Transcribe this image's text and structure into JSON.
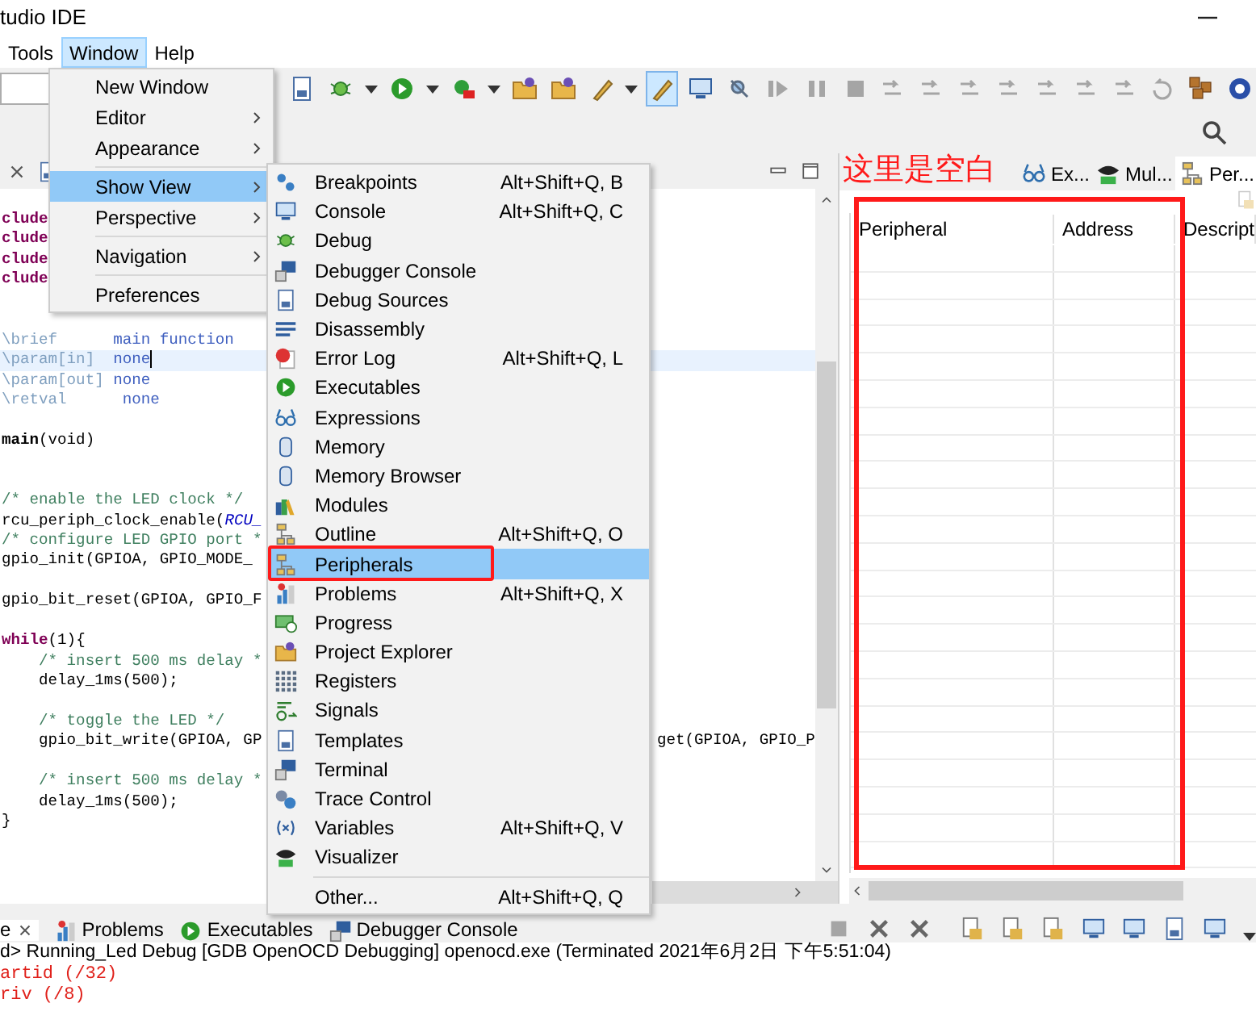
{
  "window": {
    "title": "tudio IDE"
  },
  "menubar": [
    {
      "label": "Tools",
      "selected": false
    },
    {
      "label": "Window",
      "selected": true
    },
    {
      "label": "Help",
      "selected": false
    }
  ],
  "toolbar": [
    {
      "selected": false
    },
    {
      "selected": false
    },
    {
      "selected": false
    },
    {
      "selected": false
    },
    {
      "selected": false
    },
    {
      "selected": false
    },
    {
      "selected": false
    },
    {
      "selected": false
    },
    {
      "selected": false
    },
    {
      "selected": false
    },
    {
      "selected": false
    },
    {
      "selected": true
    },
    {
      "selected": false
    },
    {
      "selected": false
    },
    {
      "selected": false
    },
    {
      "selected": false
    },
    {
      "selected": false
    },
    {
      "selected": false
    },
    {
      "selected": false
    },
    {
      "selected": false
    },
    {
      "selected": false
    },
    {
      "selected": false
    },
    {
      "selected": false
    },
    {
      "selected": false
    },
    {
      "selected": false
    },
    {
      "selected": false
    },
    {
      "selected": false
    }
  ],
  "window_menu": {
    "items": [
      {
        "kind": "item",
        "label": "New Window",
        "submenu": false,
        "selected": false
      },
      {
        "kind": "item",
        "label": "Editor",
        "submenu": true,
        "selected": false
      },
      {
        "kind": "item",
        "label": "Appearance",
        "submenu": true,
        "selected": false
      },
      {
        "kind": "separator"
      },
      {
        "kind": "item",
        "label": "Show View",
        "submenu": true,
        "selected": true
      },
      {
        "kind": "item",
        "label": "Perspective",
        "submenu": true,
        "selected": false
      },
      {
        "kind": "separator"
      },
      {
        "kind": "item",
        "label": "Navigation",
        "submenu": true,
        "selected": false
      },
      {
        "kind": "separator"
      },
      {
        "kind": "item",
        "label": "Preferences",
        "submenu": false,
        "selected": false
      }
    ]
  },
  "show_view_menu": {
    "items": [
      {
        "kind": "item",
        "label": "Breakpoints",
        "shortcut": "Alt+Shift+Q, B",
        "selected": false,
        "boxed": false
      },
      {
        "kind": "item",
        "label": "Console",
        "shortcut": "Alt+Shift+Q, C",
        "selected": false,
        "boxed": false
      },
      {
        "kind": "item",
        "label": "Debug",
        "selected": false,
        "boxed": false
      },
      {
        "kind": "item",
        "label": "Debugger Console",
        "selected": false,
        "boxed": false
      },
      {
        "kind": "item",
        "label": "Debug Sources",
        "selected": false,
        "boxed": false
      },
      {
        "kind": "item",
        "label": "Disassembly",
        "selected": false,
        "boxed": false
      },
      {
        "kind": "item",
        "label": "Error Log",
        "shortcut": "Alt+Shift+Q, L",
        "selected": false,
        "boxed": false
      },
      {
        "kind": "item",
        "label": "Executables",
        "selected": false,
        "boxed": false
      },
      {
        "kind": "item",
        "label": "Expressions",
        "selected": false,
        "boxed": false
      },
      {
        "kind": "item",
        "label": "Memory",
        "selected": false,
        "boxed": false
      },
      {
        "kind": "item",
        "label": "Memory Browser",
        "selected": false,
        "boxed": false
      },
      {
        "kind": "item",
        "label": "Modules",
        "selected": false,
        "boxed": false
      },
      {
        "kind": "item",
        "label": "Outline",
        "shortcut": "Alt+Shift+Q, O",
        "selected": false,
        "boxed": false
      },
      {
        "kind": "item",
        "label": "Peripherals",
        "selected": true,
        "boxed": true
      },
      {
        "kind": "item",
        "label": "Problems",
        "shortcut": "Alt+Shift+Q, X",
        "selected": false,
        "boxed": false
      },
      {
        "kind": "item",
        "label": "Progress",
        "selected": false,
        "boxed": false
      },
      {
        "kind": "item",
        "label": "Project Explorer",
        "selected": false,
        "boxed": false
      },
      {
        "kind": "item",
        "label": "Registers",
        "selected": false,
        "boxed": false
      },
      {
        "kind": "item",
        "label": "Signals",
        "selected": false,
        "boxed": false
      },
      {
        "kind": "item",
        "label": "Templates",
        "selected": false,
        "boxed": false
      },
      {
        "kind": "item",
        "label": "Terminal",
        "selected": false,
        "boxed": false
      },
      {
        "kind": "item",
        "label": "Trace Control",
        "selected": false,
        "boxed": false
      },
      {
        "kind": "item",
        "label": "Variables",
        "shortcut": "Alt+Shift+Q, V",
        "selected": false,
        "boxed": false
      },
      {
        "kind": "item",
        "label": "Visualizer",
        "selected": false,
        "boxed": false
      },
      {
        "kind": "separator"
      },
      {
        "kind": "item",
        "label": "Other...",
        "shortcut": "Alt+Shift+Q, Q",
        "selected": false,
        "boxed": false
      }
    ]
  },
  "editor": {
    "lines": [
      {
        "current": false,
        "left": [
          {
            "kind": "keyword",
            "text": "clude"
          }
        ]
      },
      {
        "current": false,
        "left": [
          {
            "kind": "keyword",
            "text": "clude"
          }
        ]
      },
      {
        "current": false,
        "left": [
          {
            "kind": "keyword",
            "text": "clude"
          }
        ]
      },
      {
        "current": false,
        "left": [
          {
            "kind": "keyword",
            "text": "clude"
          }
        ]
      },
      {
        "current": false
      },
      {
        "current": false
      },
      {
        "current": false,
        "left": [
          {
            "kind": "doc_tag",
            "text": "\\brief      "
          },
          {
            "kind": "doc_text",
            "text": "main function"
          }
        ]
      },
      {
        "current": true,
        "left": [
          {
            "kind": "doc_tag",
            "text": "\\param[in]  "
          },
          {
            "kind": "doc_text",
            "text": "none"
          }
        ]
      },
      {
        "current": false,
        "left": [
          {
            "kind": "doc_tag",
            "text": "\\param[out] "
          },
          {
            "kind": "doc_text",
            "text": "none"
          }
        ]
      },
      {
        "current": false,
        "left": [
          {
            "kind": "doc_tag",
            "text": "\\retval      "
          },
          {
            "kind": "doc_text",
            "text": "none"
          }
        ]
      },
      {
        "current": false
      },
      {
        "current": false,
        "left": [
          {
            "kind": "bold",
            "text": "main"
          },
          {
            "kind": "plain",
            "text": "(void)"
          }
        ]
      },
      {
        "current": false
      },
      {
        "current": false
      },
      {
        "current": false,
        "left": [
          {
            "kind": "comment",
            "text": "/* enable the LED clock */"
          }
        ]
      },
      {
        "current": false,
        "left": [
          {
            "kind": "plain",
            "text": "rcu_periph_clock_enable("
          },
          {
            "kind": "macro",
            "text": "RCU_"
          }
        ]
      },
      {
        "current": false,
        "left": [
          {
            "kind": "comment",
            "text": "/* configure LED GPIO port *"
          }
        ]
      },
      {
        "current": false,
        "left": [
          {
            "kind": "plain",
            "text": "gpio_init(GPIOA, GPIO_MODE_"
          }
        ]
      },
      {
        "current": false
      },
      {
        "current": false,
        "left": [
          {
            "kind": "plain",
            "text": "gpio_bit_reset(GPIOA, GPIO_F"
          }
        ]
      },
      {
        "current": false
      },
      {
        "current": false,
        "left": [
          {
            "kind": "keyword",
            "text": "while"
          },
          {
            "kind": "plain",
            "text": "(1){"
          }
        ]
      },
      {
        "current": false,
        "left": [
          {
            "kind": "comment",
            "text": "    /* insert 500 ms delay *"
          }
        ]
      },
      {
        "current": false,
        "left": [
          {
            "kind": "plain",
            "text": "    delay_1ms(500);"
          }
        ]
      },
      {
        "current": false
      },
      {
        "current": false,
        "left": [
          {
            "kind": "comment",
            "text": "    /* toggle the LED */"
          }
        ]
      },
      {
        "current": false,
        "left": [
          {
            "kind": "plain",
            "text": "    gpio_bit_write(GPIOA, GP"
          }
        ],
        "right": [
          {
            "kind": "plain",
            "text": "get(GPIOA, GPIO_P"
          }
        ]
      },
      {
        "current": false
      },
      {
        "current": false,
        "left": [
          {
            "kind": "comment",
            "text": "    /* insert 500 ms delay *"
          }
        ]
      },
      {
        "current": false,
        "left": [
          {
            "kind": "plain",
            "text": "    delay_1ms(500);"
          }
        ]
      },
      {
        "current": false,
        "left": [
          {
            "kind": "plain",
            "text": "}"
          }
        ]
      }
    ]
  },
  "right_panel": {
    "annotation": "这里是空白",
    "tabs": [
      {
        "label": "Ex...",
        "selected": false
      },
      {
        "label": "Mul...",
        "selected": false
      },
      {
        "label": "Per...",
        "selected": true
      }
    ],
    "table": {
      "columns": [
        "Peripheral",
        "Address",
        "Descript"
      ]
    }
  },
  "bottom_panel": {
    "tabs": [
      {
        "label": "e",
        "closable": true,
        "selected": true
      },
      {
        "label": "Problems",
        "closable": false,
        "selected": false
      },
      {
        "label": "Executables",
        "closable": false,
        "selected": false
      },
      {
        "label": "Debugger Console",
        "closable": false,
        "selected": false
      }
    ],
    "console_title": "d> Running_Led Debug [GDB OpenOCD Debugging] openocd.exe (Terminated 2021年6月2日 下午5:51:04)",
    "output": [
      "artid (/32)",
      "riv (/8)"
    ]
  }
}
